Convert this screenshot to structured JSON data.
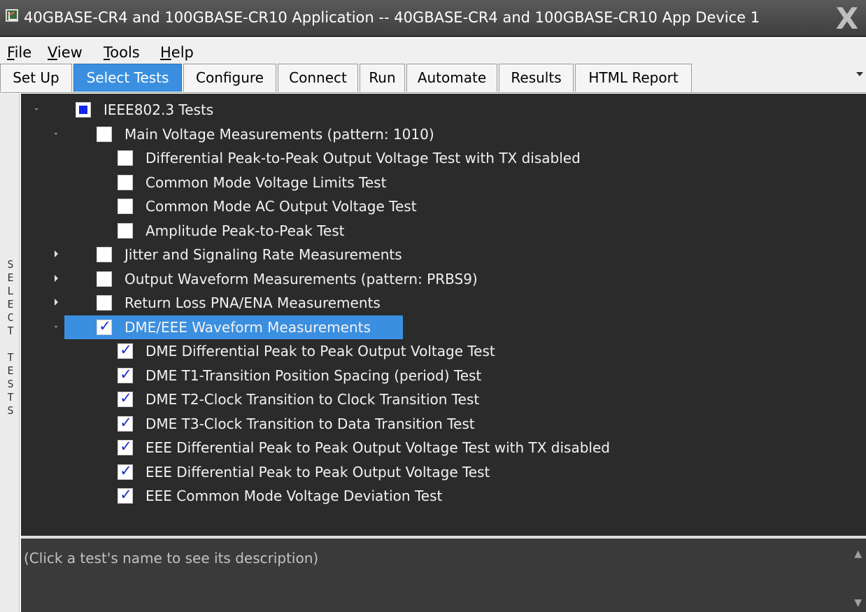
{
  "window": {
    "title": "40GBASE-CR4 and 100GBASE-CR10 Application -- 40GBASE-CR4 and 100GBASE-CR10 App Device 1",
    "close_glyph": "X"
  },
  "menu": {
    "items": [
      {
        "mnemonic": "F",
        "rest": "ile"
      },
      {
        "mnemonic": "V",
        "rest": "iew"
      },
      {
        "mnemonic": "T",
        "rest": "ools"
      },
      {
        "mnemonic": "H",
        "rest": "elp"
      }
    ]
  },
  "tabs": [
    {
      "label": "Set Up",
      "active": false
    },
    {
      "label": "Select Tests",
      "active": true
    },
    {
      "label": "Configure",
      "active": false
    },
    {
      "label": "Connect",
      "active": false
    },
    {
      "label": "Run",
      "active": false
    },
    {
      "label": "Automate",
      "active": false
    },
    {
      "label": "Results",
      "active": false
    },
    {
      "label": "HTML Report",
      "active": false
    }
  ],
  "sidebar": {
    "label": "SELECT TESTS"
  },
  "tree": {
    "rows": [
      {
        "label": "IEEE802.3 Tests",
        "level": 0,
        "expander": "expanded",
        "state": "partial",
        "selected": false
      },
      {
        "label": "Main Voltage Measurements (pattern: 1010)",
        "level": 1,
        "expander": "expanded",
        "state": "unchecked",
        "selected": false
      },
      {
        "label": "Differential Peak-to-Peak Output Voltage Test with TX disabled",
        "level": 2,
        "expander": "none",
        "state": "unchecked",
        "selected": false
      },
      {
        "label": "Common Mode Voltage Limits Test",
        "level": 2,
        "expander": "none",
        "state": "unchecked",
        "selected": false
      },
      {
        "label": "Common Mode AC Output Voltage Test",
        "level": 2,
        "expander": "none",
        "state": "unchecked",
        "selected": false
      },
      {
        "label": "Amplitude Peak-to-Peak Test",
        "level": 2,
        "expander": "none",
        "state": "unchecked",
        "selected": false
      },
      {
        "label": "Jitter and Signaling Rate Measurements",
        "level": 1,
        "expander": "collapsed",
        "state": "unchecked",
        "selected": false
      },
      {
        "label": "Output Waveform Measurements (pattern: PRBS9)",
        "level": 1,
        "expander": "collapsed",
        "state": "unchecked",
        "selected": false
      },
      {
        "label": "Return Loss PNA/ENA Measurements",
        "level": 1,
        "expander": "collapsed",
        "state": "unchecked",
        "selected": false
      },
      {
        "label": "DME/EEE Waveform Measurements",
        "level": 1,
        "expander": "expanded",
        "state": "checked",
        "selected": true
      },
      {
        "label": "DME Differential Peak to Peak Output Voltage Test",
        "level": 2,
        "expander": "none",
        "state": "checked",
        "selected": false
      },
      {
        "label": "DME T1-Transition Position Spacing (period) Test",
        "level": 2,
        "expander": "none",
        "state": "checked",
        "selected": false
      },
      {
        "label": "DME T2-Clock Transition to Clock Transition Test",
        "level": 2,
        "expander": "none",
        "state": "checked",
        "selected": false
      },
      {
        "label": "DME T3-Clock Transition to Data Transition Test",
        "level": 2,
        "expander": "none",
        "state": "checked",
        "selected": false
      },
      {
        "label": "EEE Differential Peak to Peak Output Voltage Test with TX disabled",
        "level": 2,
        "expander": "none",
        "state": "checked",
        "selected": false
      },
      {
        "label": "EEE Differential Peak to Peak Output Voltage Test",
        "level": 2,
        "expander": "none",
        "state": "checked",
        "selected": false
      },
      {
        "label": "EEE Common Mode Voltage Deviation Test",
        "level": 2,
        "expander": "none",
        "state": "checked",
        "selected": false
      }
    ]
  },
  "description": {
    "text": "(Click a test's name to see its description)"
  },
  "glyphs": {
    "check": "✓",
    "scroll_up": "▲",
    "scroll_down": "▼"
  },
  "colors": {
    "accent": "#3b8fe0",
    "tree_bg": "#2b2b2b",
    "partial_fill": "#1426e8",
    "check_color": "#1a2ccc"
  }
}
